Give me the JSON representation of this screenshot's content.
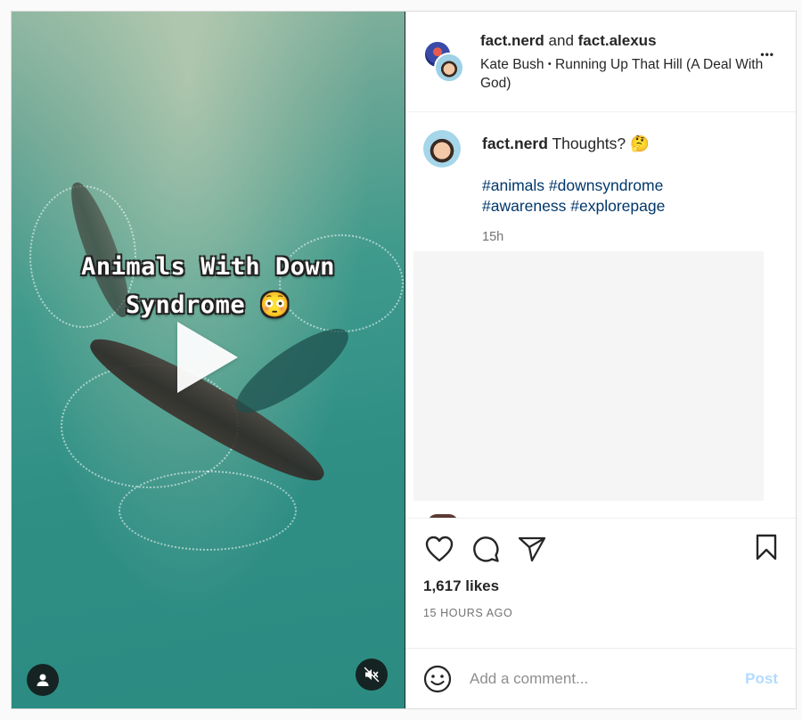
{
  "video": {
    "caption_line1": "Animals With Down",
    "caption_line2": "Syndrome 😳"
  },
  "header": {
    "user1": "fact.nerd",
    "joiner": "and",
    "user2": "fact.alexus",
    "artist": "Kate Bush",
    "separator": "•",
    "song": "Running Up That Hill (A Deal With God)",
    "more": "•••"
  },
  "post": {
    "username": "fact.nerd",
    "text": "Thoughts? 🤔",
    "hashtags": [
      "#animals",
      "#downsyndrome",
      "#awareness",
      "#explorepage"
    ],
    "time": "15h"
  },
  "actions": {
    "likes": "1,617 likes",
    "time_ago": "15 HOURS AGO"
  },
  "comment": {
    "placeholder": "Add a comment...",
    "post_label": "Post"
  },
  "colors": {
    "link": "#00376b",
    "post_disabled": "#b3dbff",
    "border": "#dbdbdb"
  }
}
